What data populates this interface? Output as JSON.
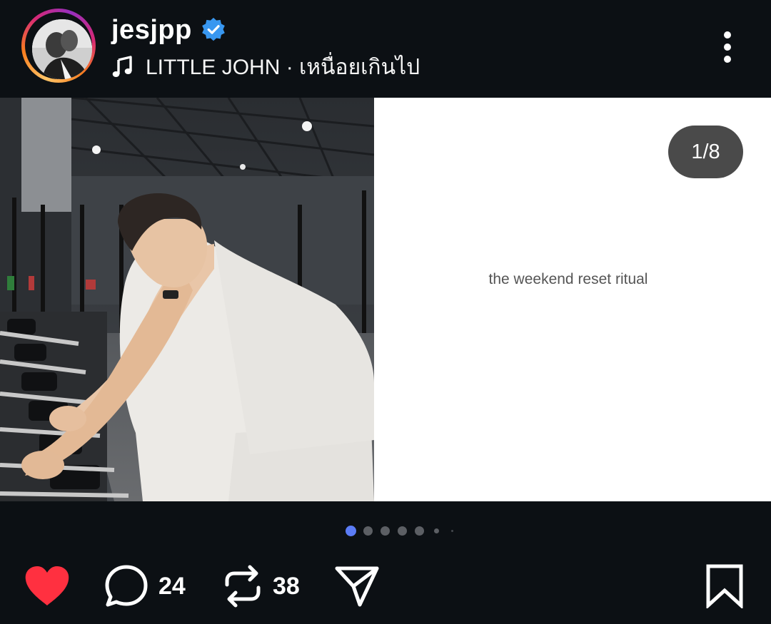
{
  "post_header": {
    "username": "jesjpp",
    "verified_icon": "verified-badge-icon",
    "music_icon": "music-note-icon",
    "music_text": "LITTLE JOHN · เหนื่อยเกินไป",
    "more_icon": "more-vertical-icon"
  },
  "carousel": {
    "slide_text": "the weekend reset ritual",
    "counter": "1/8",
    "total_slides": 8,
    "current_slide": 1
  },
  "actions": {
    "like_icon": "heart-filled-icon",
    "comment_icon": "comment-icon",
    "comment_count": "24",
    "repost_icon": "repost-icon",
    "repost_count": "38",
    "share_icon": "send-icon",
    "save_icon": "bookmark-icon"
  },
  "colors": {
    "background": "#0c1014",
    "like_red": "#ff3040",
    "verified_blue": "#3897f0",
    "active_dot": "#5b7cf6"
  }
}
